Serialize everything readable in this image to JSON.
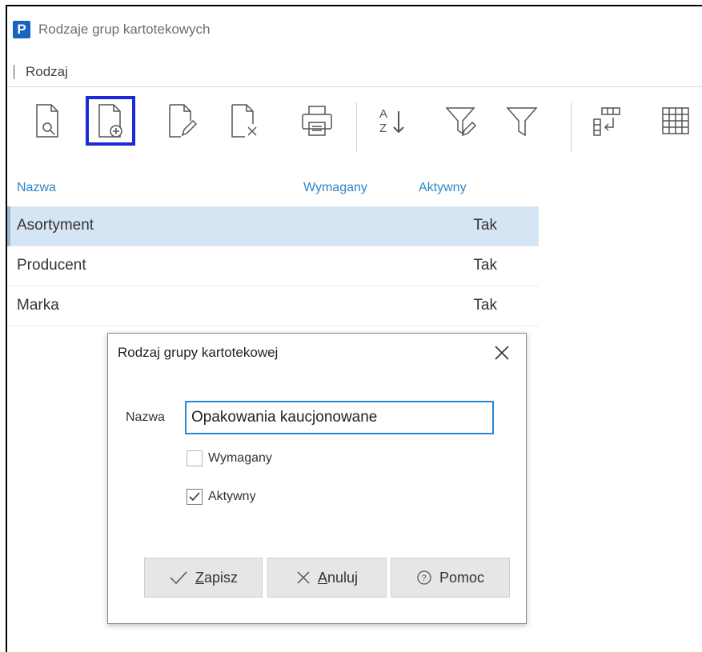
{
  "window": {
    "title": "Rodzaje grup kartotekowych",
    "logo_letter": "P"
  },
  "menu": {
    "items": [
      "Rodzaj"
    ]
  },
  "toolbar": {
    "buttons": [
      {
        "icon": "document-preview-icon"
      },
      {
        "icon": "document-add-icon",
        "selected": true
      },
      {
        "icon": "document-edit-icon"
      },
      {
        "icon": "document-delete-icon"
      },
      {
        "icon": "printer-icon"
      },
      {
        "icon": "sort-az-icon"
      },
      {
        "icon": "filter-edit-icon"
      },
      {
        "icon": "filter-icon"
      },
      {
        "icon": "column-select-icon"
      },
      {
        "icon": "grid-icon"
      }
    ]
  },
  "grid": {
    "columns": {
      "name": "Nazwa",
      "required": "Wymagany",
      "active": "Aktywny"
    },
    "rows": [
      {
        "name": "Asortyment",
        "required": "",
        "active": "Tak"
      },
      {
        "name": "Producent",
        "required": "",
        "active": "Tak"
      },
      {
        "name": "Marka",
        "required": "",
        "active": "Tak"
      }
    ]
  },
  "dialog": {
    "title": "Rodzaj grupy kartotekowej",
    "name_label": "Nazwa",
    "name_value": "Opakowania kaucjonowane",
    "required_label": "Wymagany",
    "required_checked": false,
    "active_label": "Aktywny",
    "active_checked": true,
    "save": {
      "mnemonic": "Z",
      "rest": "apisz"
    },
    "cancel": {
      "mnemonic": "A",
      "rest": "nuluj"
    },
    "help_label": "Pomoc"
  },
  "colors": {
    "accent": "#1a2bd6",
    "header_text": "#2e86c8",
    "selected_row": "#d6e5f3",
    "input_border": "#2d84d4"
  }
}
